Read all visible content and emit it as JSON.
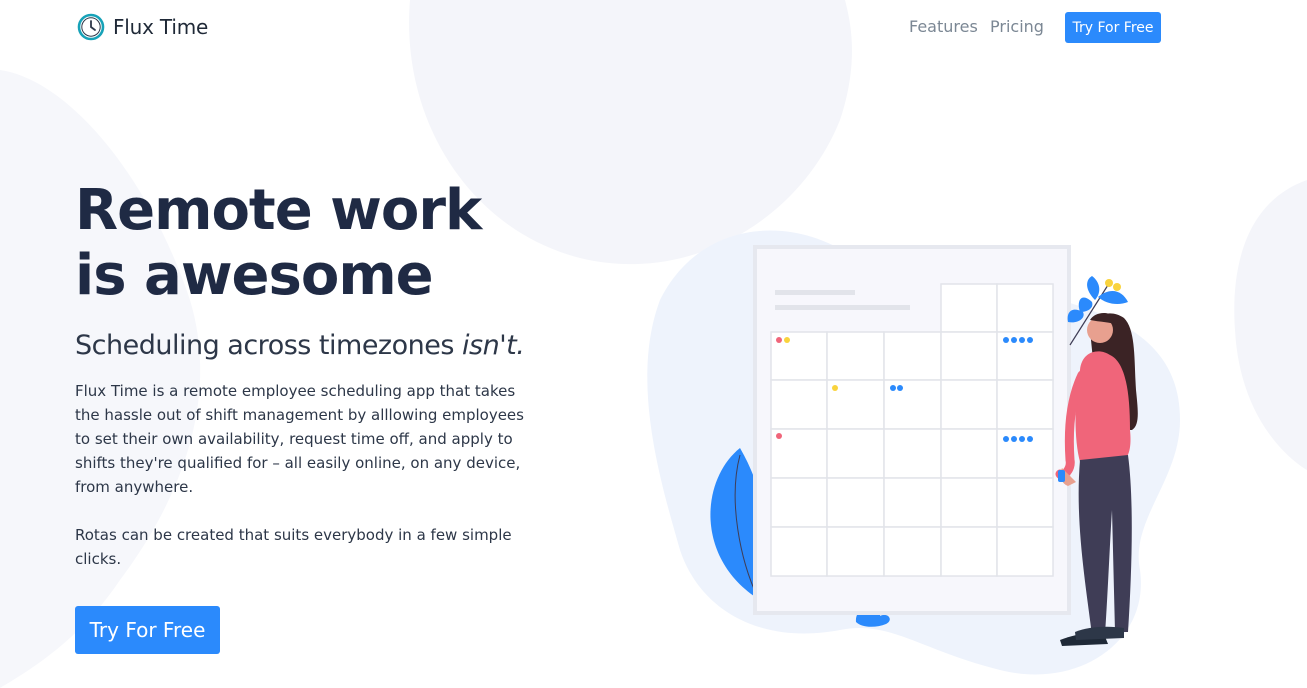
{
  "brand": {
    "name": "Flux Time",
    "icon": "clock-icon",
    "accent": "#2b8afc",
    "logo_color": "#17a2b8"
  },
  "nav": {
    "links": [
      "Features",
      "Pricing"
    ],
    "cta": "Try For Free"
  },
  "hero": {
    "headline": "Remote work is awesome",
    "subhead_main": "Scheduling across timezones",
    "subhead_emphasis": "isn't.",
    "paragraph_1": "Flux Time is a remote employee scheduling app that takes the hassle out of shift management by alllowing employees to set their own availability, request time off, and apply to shifts they're qualified for – all easily online, on any device, from anywhere.",
    "paragraph_2": "Rotas can be created that suits everybody in a few simple clicks.",
    "cta": "Try For Free"
  },
  "illustration": {
    "name": "calendar-with-woman-illustration",
    "colors": {
      "pink": "#f0657a",
      "yellow": "#f9d33d",
      "blue": "#2b8afc",
      "hair": "#3b2325",
      "pants": "#3f3d56",
      "grid": "#e2e4ea",
      "board": "#f7f7fc"
    }
  }
}
